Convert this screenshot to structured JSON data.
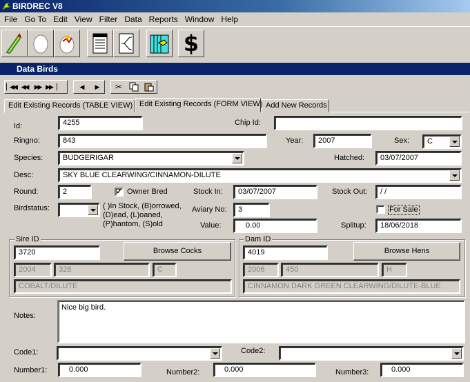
{
  "app": {
    "title": "BIRDREC V8"
  },
  "menu": [
    "File",
    "Go To",
    "Edit",
    "View",
    "Filter",
    "Data",
    "Reports",
    "Window",
    "Help"
  ],
  "toolbar": {
    "icons": [
      "bird-tool-icon",
      "egg-icon",
      "hatching-egg-icon",
      "document-list-icon",
      "pedigree-icon",
      "aviary-icon",
      "dollar-icon"
    ],
    "dollar": "$"
  },
  "child_window": {
    "title": "Data Birds"
  },
  "tabs": [
    "Edit Existing Records (TABLE VIEW)",
    "Edit Existing Records (FORM VIEW)",
    "Add New Records"
  ],
  "form": {
    "id_label": "Id:",
    "id": "4255",
    "chip_label": "Chip Id:",
    "chip": "",
    "ringno_label": "Ringno:",
    "ringno": "843",
    "year_label": "Year:",
    "year": "2007",
    "sex_label": "Sex:",
    "sex": "C",
    "species_label": "Species:",
    "species": "BUDGERIGAR",
    "hatched_label": "Hatched:",
    "hatched": "03/07/2007",
    "desc_label": "Desc:",
    "desc": "SKY BLUE CLEARWING/CINNAMON-DILUTE",
    "round_label": "Round:",
    "round": "2",
    "owner_bred_label": "Owner Bred",
    "owner_bred_mark": "✓",
    "stock_in_label": "Stock In:",
    "stock_in": "03/07/2007",
    "stock_out_label": "Stock Out:",
    "stock_out": " / /",
    "birdstatus_label": "Birdstatus:",
    "birdstatus": "",
    "status_help_1": "( )In Stock, (B)orrowed,",
    "status_help_2": "(D)ead, (L)oaned,",
    "status_help_3": "(P)hantom, (S)old",
    "aviary_label": "Aviary No:",
    "aviary": "3",
    "for_sale_label": "For Sale",
    "value_label": "Value:",
    "value": "0.00",
    "splitup_label": "Splitup:",
    "splitup": "18/06/2018",
    "notes_label": "Notes:",
    "notes": "Nice big bird.",
    "code1_label": "Code1:",
    "code1": "",
    "code2_label": "Code2:",
    "code2": "",
    "number1_label": "Number1:",
    "number1": "0.000",
    "number2_label": "Number2:",
    "number2": "0.000",
    "number3_label": "Number3:",
    "number3": "0.000"
  },
  "sire": {
    "title": "Sire ID",
    "id": "3720",
    "browse": "Browse Cocks",
    "year": "2004",
    "ring": "328",
    "sex": "C",
    "desc": "COBALT/DILUTE"
  },
  "dam": {
    "title": "Dam ID",
    "id": "4019",
    "browse": "Browse Hens",
    "year": "2006",
    "ring": "450",
    "sex": "H",
    "desc": "CINNAMON DARK GREEN CLEARWING/DILUTE-BLUE"
  }
}
